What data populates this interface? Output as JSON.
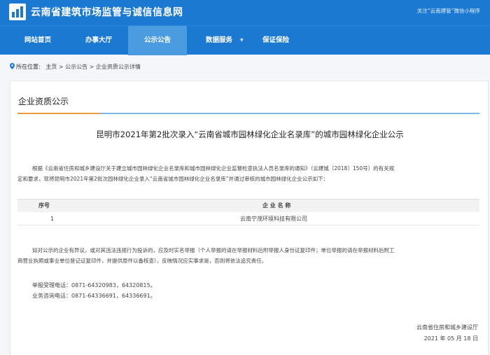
{
  "header": {
    "site_title": "云南省建筑市场监管与诚信信息网",
    "follow_text": "关注“云南建管”微信小程序"
  },
  "nav": {
    "items": [
      {
        "label": "网站首页"
      },
      {
        "label": "办事大厅"
      },
      {
        "label": "公示公告"
      },
      {
        "label": "数据服务"
      },
      {
        "label": "保证保险"
      }
    ],
    "dropdown_arrow": "▼",
    "active_color": "#4a9be0"
  },
  "breadcrumb": {
    "prefix": "所在位置:",
    "path": "主页 > 公示公告 > 企业资质公示详情"
  },
  "section": {
    "title": "企业资质公示",
    "accent_color": "#f09a3e",
    "line_color": "#7fb6e9"
  },
  "notice": {
    "headline": "昆明市2021年第2批次录入“云南省城市园林绿化企业名录库”的城市园林绿化企业公示",
    "intro_line1": "根据《云南省住房和城乡建设厅关于建立城市园林绿化企业名录库和城市园林绿化企业监督检查执法人员名录库的通知》（云建城〔2018〕150号）的有关规",
    "intro_line2": "定和要求，现将昆明市2021年第2批次园林绿化企业录入“云南省城市园林绿化企业名录库”并通过审核的城市园林绿化企业公示如下：",
    "table": {
      "headers": {
        "no": "序号",
        "name": "企 业 名 称"
      },
      "rows": [
        {
          "no": "1",
          "name": "云南宁茂环境科技有限公司"
        }
      ]
    },
    "objection_line1": "如对公示的企业有异议，或对其违法违规行为投诉的，应及时实名举报（个人举报的请在举报材料后附举报人身份证复印件；单位举报的请在举报材料后附工",
    "objection_line2": "商营业执照或事业单位登记证复印件，并提供原件以备核查），反映情况应实事求是，否则将依法追究责任。",
    "report_phone": "举报受理电话：0871-64320983，64320815。",
    "consult_phone": "业务咨询电话：0871-64336691，64336691。",
    "signer": "云南省住房和城乡建设厅",
    "date": "2021 年 05 月 18 日"
  }
}
